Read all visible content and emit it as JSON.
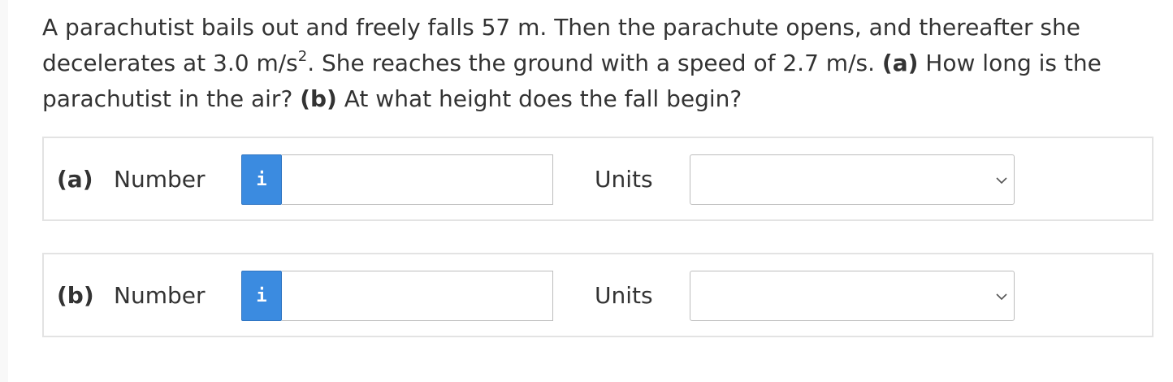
{
  "question": {
    "line1": "A parachutist bails out and freely falls 57 m. Then the parachute opens, and thereafter she",
    "line2_pre": "decelerates at 3.0 m/s",
    "line2_sup": "2",
    "line2_post": ". She reaches the ground with a speed of 2.7 m/s.",
    "part_a_tag": "(a)",
    "part_a_text": " How long is the",
    "line3_pre": "parachutist in the air?",
    "part_b_tag": "(b)",
    "part_b_text": " At what height does the fall begin?"
  },
  "answers": [
    {
      "part": "(a)",
      "number_label": "Number",
      "info_glyph": "i",
      "number_value": "",
      "units_label": "Units",
      "units_value": ""
    },
    {
      "part": "(b)",
      "number_label": "Number",
      "info_glyph": "i",
      "number_value": "",
      "units_label": "Units",
      "units_value": ""
    }
  ],
  "icons": {
    "info": "info-icon",
    "dropdown": "chevron-down-icon"
  },
  "colors": {
    "info_button": "#3b8be0",
    "text": "#333333",
    "border": "#e3e3e3"
  }
}
